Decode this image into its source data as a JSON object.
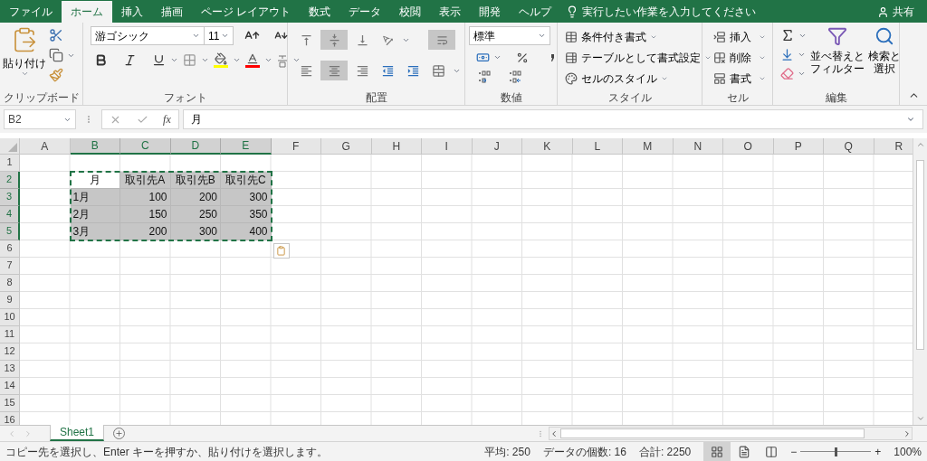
{
  "tabs": [
    {
      "label": "ファイル",
      "selected": false
    },
    {
      "label": "ホーム",
      "selected": true
    },
    {
      "label": "挿入",
      "selected": false
    },
    {
      "label": "描画",
      "selected": false
    },
    {
      "label": "ページ レイアウト",
      "selected": false
    },
    {
      "label": "数式",
      "selected": false
    },
    {
      "label": "データ",
      "selected": false
    },
    {
      "label": "校閲",
      "selected": false
    },
    {
      "label": "表示",
      "selected": false
    },
    {
      "label": "開発",
      "selected": false
    },
    {
      "label": "ヘルプ",
      "selected": false
    }
  ],
  "tell_me": "実行したい作業を入力してください",
  "share": "共有",
  "ribbon": {
    "clipboard": {
      "label": "クリップボード",
      "paste": "貼り付け"
    },
    "font": {
      "label": "フォント",
      "font_name": "游ゴシック",
      "font_size": "11"
    },
    "alignment": {
      "label": "配置"
    },
    "number": {
      "label": "数値",
      "format": "標準"
    },
    "styles": {
      "label": "スタイル",
      "items": [
        "条件付き書式",
        "テーブルとして書式設定",
        "セルのスタイル"
      ]
    },
    "cells": {
      "label": "セル",
      "items": [
        "挿入",
        "削除",
        "書式"
      ]
    },
    "editing": {
      "label": "編集",
      "sort": [
        "並べ替えと",
        "フィルター"
      ],
      "find": [
        "検索と",
        "選択"
      ]
    }
  },
  "formula_bar": {
    "name_box": "B2",
    "fx": "fx",
    "value": "月"
  },
  "grid": {
    "columns": [
      {
        "label": "A",
        "selected": false
      },
      {
        "label": "B",
        "selected": true
      },
      {
        "label": "C",
        "selected": true
      },
      {
        "label": "D",
        "selected": true
      },
      {
        "label": "E",
        "selected": true
      },
      {
        "label": "F",
        "selected": false
      },
      {
        "label": "G",
        "selected": false
      },
      {
        "label": "H",
        "selected": false
      },
      {
        "label": "I",
        "selected": false
      },
      {
        "label": "J",
        "selected": false
      },
      {
        "label": "K",
        "selected": false
      },
      {
        "label": "L",
        "selected": false
      },
      {
        "label": "M",
        "selected": false
      },
      {
        "label": "N",
        "selected": false
      },
      {
        "label": "O",
        "selected": false
      },
      {
        "label": "P",
        "selected": false
      },
      {
        "label": "Q",
        "selected": false
      },
      {
        "label": "R",
        "selected": false
      }
    ],
    "copy_marquee": true,
    "paste_options": true,
    "rows": [
      {
        "header": "1",
        "selected": false,
        "cells": []
      },
      {
        "header": "2",
        "selected": true,
        "cells": [
          {
            "selected": false,
            "active": false
          },
          {
            "text": "月",
            "kind": "header",
            "selected": true,
            "active": true
          },
          {
            "text": "取引先A",
            "kind": "header",
            "selected": true,
            "active": false
          },
          {
            "text": "取引先B",
            "kind": "header",
            "selected": true,
            "active": false
          },
          {
            "text": "取引先C",
            "kind": "header",
            "selected": true,
            "active": false
          }
        ]
      },
      {
        "header": "3",
        "selected": true,
        "cells": [
          {
            "selected": false,
            "active": false
          },
          {
            "text": "1月",
            "kind": "label",
            "selected": true,
            "active": false
          },
          {
            "text": "100",
            "kind": "number",
            "selected": true,
            "active": false
          },
          {
            "text": "200",
            "kind": "number",
            "selected": true,
            "active": false
          },
          {
            "text": "300",
            "kind": "number",
            "selected": true,
            "active": false
          }
        ]
      },
      {
        "header": "4",
        "selected": true,
        "cells": [
          {
            "selected": false,
            "active": false
          },
          {
            "text": "2月",
            "kind": "label",
            "selected": true,
            "active": false
          },
          {
            "text": "150",
            "kind": "number",
            "selected": true,
            "active": false
          },
          {
            "text": "250",
            "kind": "number",
            "selected": true,
            "active": false
          },
          {
            "text": "350",
            "kind": "number",
            "selected": true,
            "active": false
          }
        ]
      },
      {
        "header": "5",
        "selected": true,
        "cells": [
          {
            "selected": false,
            "active": false
          },
          {
            "text": "3月",
            "kind": "label",
            "selected": true,
            "active": false
          },
          {
            "text": "200",
            "kind": "number",
            "selected": true,
            "active": false
          },
          {
            "text": "300",
            "kind": "number",
            "selected": true,
            "active": false
          },
          {
            "text": "400",
            "kind": "number",
            "selected": true,
            "active": false
          }
        ]
      },
      {
        "header": "6",
        "selected": false,
        "cells": []
      },
      {
        "header": "7",
        "selected": false,
        "cells": []
      },
      {
        "header": "8",
        "selected": false,
        "cells": []
      },
      {
        "header": "9",
        "selected": false,
        "cells": []
      },
      {
        "header": "10",
        "selected": false,
        "cells": []
      },
      {
        "header": "11",
        "selected": false,
        "cells": []
      },
      {
        "header": "12",
        "selected": false,
        "cells": []
      },
      {
        "header": "13",
        "selected": false,
        "cells": []
      },
      {
        "header": "14",
        "selected": false,
        "cells": []
      },
      {
        "header": "15",
        "selected": false,
        "cells": []
      },
      {
        "header": "16",
        "selected": false,
        "cells": []
      }
    ]
  },
  "sheets": [
    {
      "label": "Sheet1",
      "selected": true
    }
  ],
  "status_bar": {
    "message": "コピー先を選択し、Enter キーを押すか、貼り付けを選択します。",
    "stats": [
      "平均: 250",
      "データの個数: 16",
      "合計: 2250"
    ],
    "views": [
      {
        "kind": "normal",
        "selected": true
      },
      {
        "kind": "page_layout",
        "selected": false
      },
      {
        "kind": "page_break",
        "selected": false
      }
    ],
    "zoom_minus": "−",
    "zoom_plus": "+",
    "zoom": {
      "level": 0.5
    },
    "zoom_label": "100%"
  }
}
